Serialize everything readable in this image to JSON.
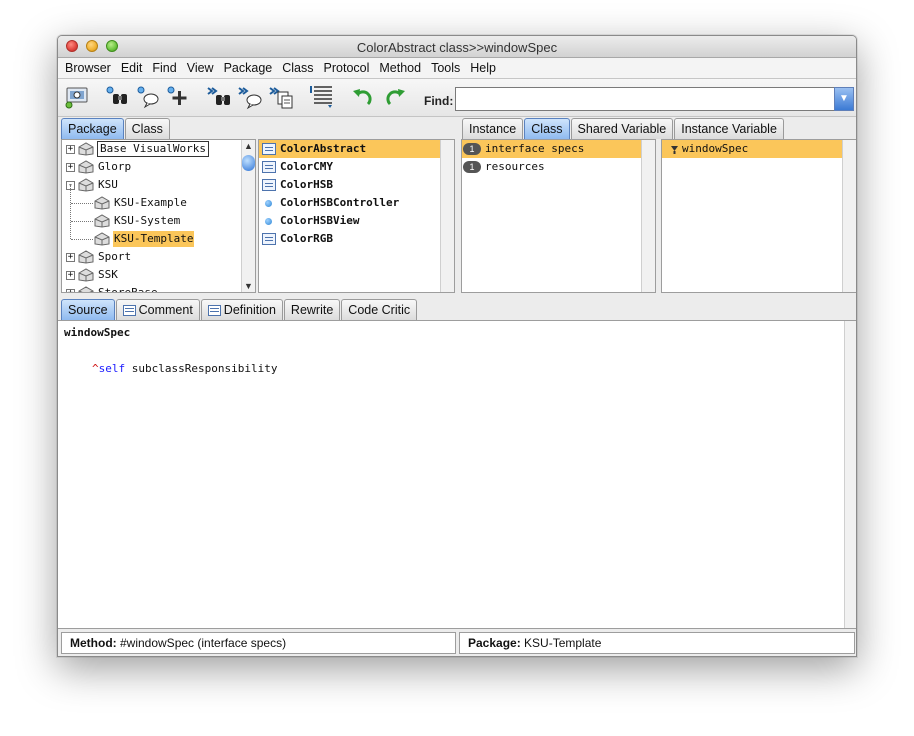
{
  "window": {
    "title": "ColorAbstract class>>windowSpec"
  },
  "menu": [
    "Browser",
    "Edit",
    "Find",
    "View",
    "Package",
    "Class",
    "Protocol",
    "Method",
    "Tools",
    "Help"
  ],
  "toolbar": {
    "find_label": "Find:",
    "find_value": ""
  },
  "left_tabs": [
    {
      "label": "Package",
      "active": true
    },
    {
      "label": "Class",
      "active": false
    }
  ],
  "packages": [
    {
      "label": "Base VisualWorks",
      "expander": "+",
      "boxed": true
    },
    {
      "label": "Glorp",
      "expander": "+"
    },
    {
      "label": "KSU",
      "expander": "-"
    },
    {
      "label": "KSU-Example",
      "child": true
    },
    {
      "label": "KSU-System",
      "child": true
    },
    {
      "label": "KSU-Template",
      "child": true,
      "selected": true
    },
    {
      "label": "Sport",
      "expander": "+"
    },
    {
      "label": "SSK",
      "expander": "+"
    },
    {
      "label": "StoreBase",
      "expander": "+"
    }
  ],
  "classes": [
    {
      "label": "ColorAbstract",
      "icon": "class-icon",
      "selected": true
    },
    {
      "label": "ColorCMY",
      "icon": "class-icon"
    },
    {
      "label": "ColorHSB",
      "icon": "class-icon"
    },
    {
      "label": "ColorHSBController",
      "icon": "class-dot-icon"
    },
    {
      "label": "ColorHSBView",
      "icon": "class-dot-icon"
    },
    {
      "label": "ColorRGB",
      "icon": "class-icon"
    }
  ],
  "right_tabs": [
    {
      "label": "Instance",
      "active": false
    },
    {
      "label": "Class",
      "active": true
    },
    {
      "label": "Shared Variable",
      "active": false
    },
    {
      "label": "Instance Variable",
      "active": false
    }
  ],
  "protocols": [
    {
      "label": "interface specs",
      "count": "1",
      "selected": true
    },
    {
      "label": "resources",
      "count": "1"
    }
  ],
  "methods": [
    {
      "label": "windowSpec",
      "selected": true
    }
  ],
  "code_tabs": [
    {
      "label": "Source",
      "active": true,
      "icon": false
    },
    {
      "label": "Comment",
      "active": false,
      "icon": true
    },
    {
      "label": "Definition",
      "active": false,
      "icon": true
    },
    {
      "label": "Rewrite",
      "active": false,
      "icon": false
    },
    {
      "label": "Code Critic",
      "active": false,
      "icon": false
    }
  ],
  "code": {
    "selector": "windowSpec",
    "caret": "^",
    "receiver": "self",
    "message": " subclassResponsibility",
    "receiver_color": "#1a1aff",
    "caret_color": "#d01010"
  },
  "status": {
    "method_label": "Method:",
    "method_value": " #windowSpec (interface specs)",
    "package_label": "Package:",
    "package_value": " KSU-Template"
  },
  "colors": {
    "selection": "#fbc65a",
    "active_tab": "#8fbaf0"
  }
}
